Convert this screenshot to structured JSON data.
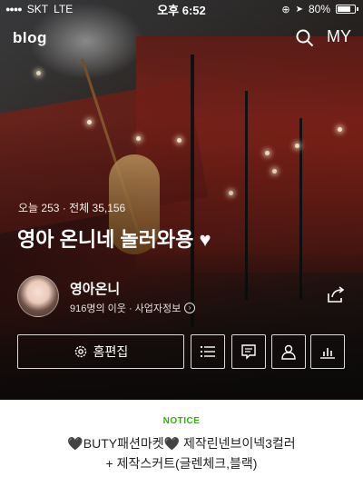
{
  "status_bar": {
    "carrier": "SKT",
    "network": "LTE",
    "time": "오후 6:52",
    "battery": "80%",
    "battery_level": 0.8
  },
  "header": {
    "logo": "blog",
    "search_icon": "search-icon",
    "my_label": "MY"
  },
  "blog": {
    "visits": "오늘 253 · 전체 35,156",
    "title": "영아 온니네 놀러와용 ♥"
  },
  "profile": {
    "nickname": "영아온니",
    "meta": "916명의 이웃 · 사업자정보",
    "meta_icon": "chevron-right-icon"
  },
  "actions": {
    "edit_label": "홈편집",
    "icons": [
      "list-icon",
      "chat-icon",
      "neighbor-icon",
      "stats-icon"
    ]
  },
  "notice": {
    "label": "NOTICE",
    "line1": "🖤BUTY패션마켓🖤 제작린넨브이넥3컬러",
    "line2": "+ 제작스커트(글렌체크,블랙)"
  },
  "colors": {
    "notice_green": "#2db400",
    "hero_red": "#7a201a",
    "text_dark": "#222222"
  }
}
